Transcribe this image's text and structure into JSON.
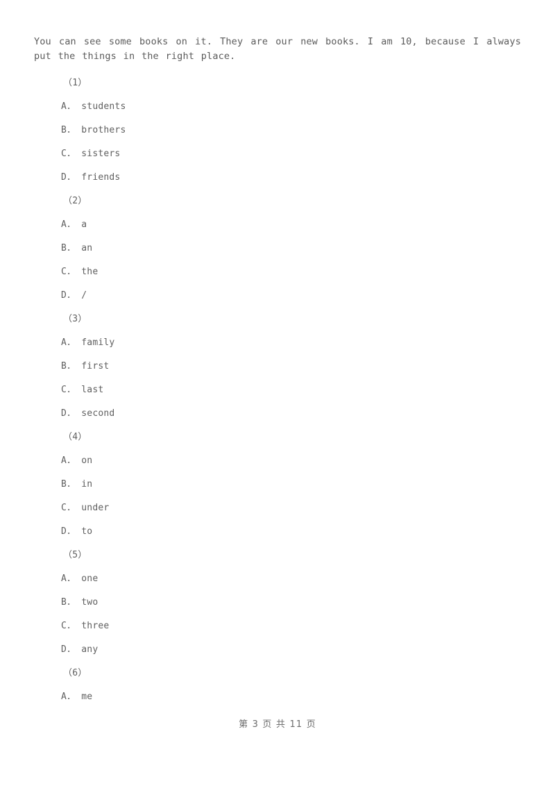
{
  "document": {
    "passage_text": "You can see some books on it. They are our new books. I am 10, because I always put the things in the right place.",
    "footer_text": "第 3 页 共 11 页",
    "text_color": "#5a5a5a",
    "background_color": "#ffffff",
    "page_number": "3",
    "total_pages": "11"
  },
  "questions": [
    {
      "number": "（1）",
      "options": [
        {
          "letter": "A",
          "sep": "．",
          "text": "students"
        },
        {
          "letter": "B",
          "sep": "．",
          "text": "brothers"
        },
        {
          "letter": "C",
          "sep": "．",
          "text": "sisters"
        },
        {
          "letter": "D",
          "sep": "．",
          "text": "friends"
        }
      ]
    },
    {
      "number": "（2）",
      "options": [
        {
          "letter": "A",
          "sep": "．",
          "text": "a"
        },
        {
          "letter": "B",
          "sep": "．",
          "text": "an"
        },
        {
          "letter": "C",
          "sep": "．",
          "text": "the"
        },
        {
          "letter": "D",
          "sep": "．",
          "text": "/"
        }
      ]
    },
    {
      "number": "（3）",
      "options": [
        {
          "letter": "A",
          "sep": "．",
          "text": "family"
        },
        {
          "letter": "B",
          "sep": "．",
          "text": "first"
        },
        {
          "letter": "C",
          "sep": "．",
          "text": "last"
        },
        {
          "letter": "D",
          "sep": "．",
          "text": "second"
        }
      ]
    },
    {
      "number": "（4）",
      "options": [
        {
          "letter": "A",
          "sep": "．",
          "text": "on"
        },
        {
          "letter": "B",
          "sep": "．",
          "text": "in"
        },
        {
          "letter": "C",
          "sep": "．",
          "text": "under"
        },
        {
          "letter": "D",
          "sep": "．",
          "text": "to"
        }
      ]
    },
    {
      "number": "（5）",
      "options": [
        {
          "letter": "A",
          "sep": "．",
          "text": "one"
        },
        {
          "letter": "B",
          "sep": "．",
          "text": "two"
        },
        {
          "letter": "C",
          "sep": "．",
          "text": "three"
        },
        {
          "letter": "D",
          "sep": "．",
          "text": "any"
        }
      ]
    },
    {
      "number": "（6）",
      "options": [
        {
          "letter": "A",
          "sep": "．",
          "text": "me"
        }
      ]
    }
  ]
}
